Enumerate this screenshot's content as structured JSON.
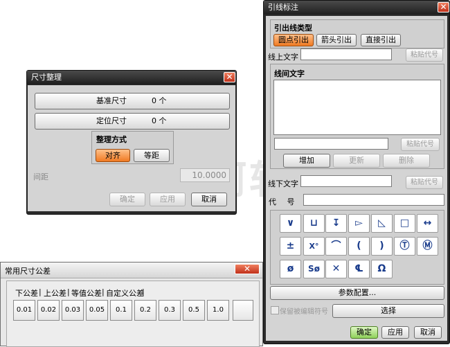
{
  "size_dialog": {
    "title": "尺寸整理",
    "row1": {
      "label": "基准尺寸",
      "count": "0 个"
    },
    "row2": {
      "label": "定位尺寸",
      "count": "0 个"
    },
    "method_group": "整理方式",
    "align_label": "对齐",
    "equal_label": "等距",
    "spacing_label": "间距",
    "spacing_value": "10.0000",
    "ok_label": "确定",
    "apply_label": "应用",
    "cancel_label": "取消"
  },
  "watermark": "天河软件",
  "tolerance_dialog": {
    "title": "常用尺寸公差",
    "tabs": [
      "下公差",
      "上公差",
      "等值公差",
      "自定义公差"
    ],
    "values": [
      "0.01",
      "0.02",
      "0.03",
      "0.05",
      "0.1",
      "0.2",
      "0.3",
      "0.5",
      "1.0",
      ""
    ]
  },
  "leader_dialog": {
    "title": "引线标注",
    "type_group": "引出线类型",
    "type_buttons": [
      "圆点引出",
      "箭头引出",
      "直接引出"
    ],
    "above_text_label": "线上文字",
    "paste_label": "粘贴代号",
    "between_text_group": "线间文字",
    "add_label": "增加",
    "update_label": "更新",
    "delete_label": "删除",
    "below_text_label": "线下文字",
    "code_label": "代 号",
    "symbols": [
      "∨",
      "⊔",
      "↧",
      "▻",
      "◺",
      "□",
      "↔",
      "±",
      "X°",
      "⌒",
      "(",
      ")",
      "Ⓣ",
      "Ⓜ",
      "ø",
      "Sø",
      "✕",
      "℄",
      "Ω"
    ],
    "param_config_label": "参数配置...",
    "keep_code_label": "保留被编辑符号",
    "select_label": "选择",
    "ok_label": "确定",
    "apply_label": "应用",
    "cancel_label": "取消"
  },
  "colors": {
    "accent_orange": "#f07a22",
    "symbol_blue": "#1a3c8c",
    "confirm_green": "#8fd15a"
  }
}
